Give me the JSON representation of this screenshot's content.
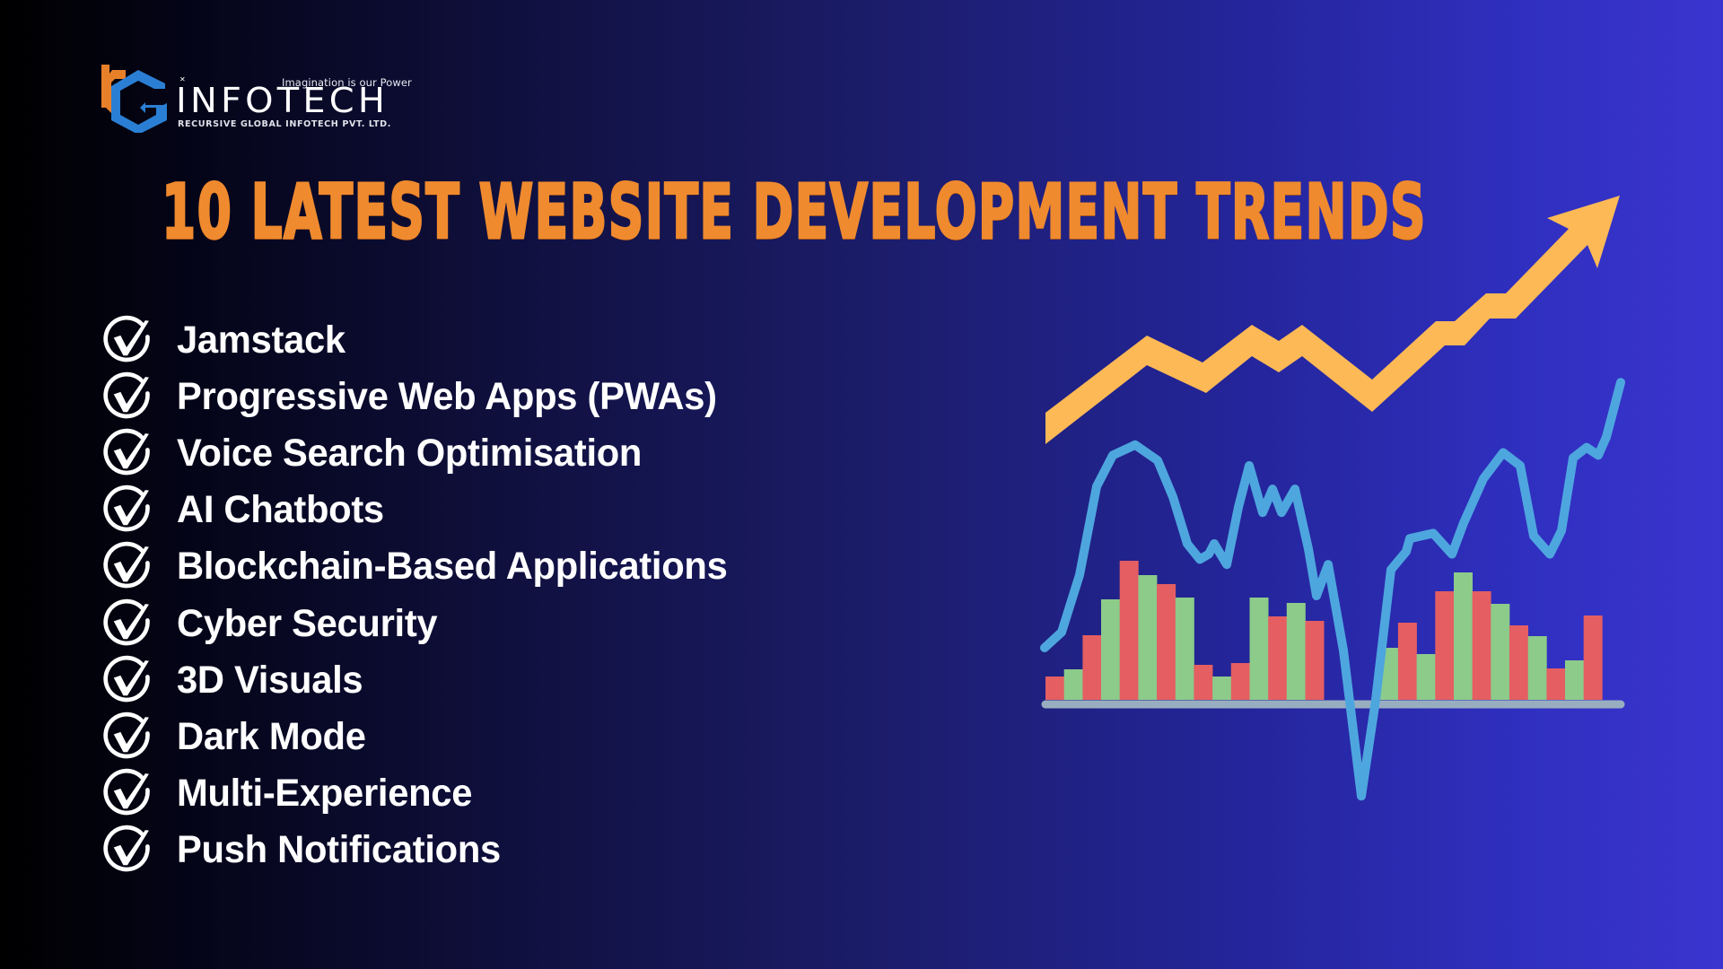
{
  "logo": {
    "mark_letters": "rG",
    "name": "INFOTECH",
    "tagline": "Imagination is our Power",
    "company": "RECURSIVE GLOBAL INFOTECH PVT. LTD.",
    "colors": {
      "r": "#e8802a",
      "g": "#2a7fd4"
    }
  },
  "title": "10 LATEST WEBSITE DEVELOPMENT TRENDS",
  "trends": [
    {
      "label": "Jamstack",
      "icon": "check-circle-icon"
    },
    {
      "label": "Progressive Web Apps (PWAs)",
      "icon": "check-circle-icon"
    },
    {
      "label": "Voice Search Optimisation",
      "icon": "check-circle-icon"
    },
    {
      "label": "AI Chatbots",
      "icon": "check-circle-icon"
    },
    {
      "label": "Blockchain-Based Applications",
      "icon": "check-circle-icon"
    },
    {
      "label": "Cyber Security",
      "icon": "check-circle-icon"
    },
    {
      "label": "3D Visuals",
      "icon": "check-circle-icon"
    },
    {
      "label": "Dark Mode",
      "icon": "check-circle-icon"
    },
    {
      "label": "Multi-Experience",
      "icon": "check-circle-icon"
    },
    {
      "label": "Push Notifications",
      "icon": "check-circle-icon"
    }
  ],
  "colors": {
    "title": "#ef8a2e",
    "arrow": "#fdb956",
    "line": "#4ea6de",
    "bar_red": "#e45e62",
    "bar_green": "#8ccb8a",
    "baseline": "#98aec0"
  },
  "chart_data": {
    "type": "bar",
    "title": "",
    "description": "Decorative growth illustration: upward zig-zag arrow, wavy trend line and red/green bar histogram",
    "groups": [
      {
        "name": "left-group",
        "colors": [
          "red",
          "green",
          "red",
          "green",
          "red",
          "green",
          "red",
          "green",
          "red",
          "green",
          "red",
          "green",
          "red",
          "green",
          "red"
        ],
        "values": [
          26,
          34,
          72,
          112,
          155,
          139,
          129,
          114,
          39,
          26,
          41,
          114,
          93,
          108,
          88
        ]
      },
      {
        "name": "right-group",
        "colors": [
          "green",
          "red",
          "green",
          "red",
          "green",
          "red",
          "green",
          "red",
          "green",
          "red",
          "green",
          "red"
        ],
        "values": [
          58,
          86,
          51,
          121,
          142,
          121,
          107,
          83,
          71,
          35,
          44,
          94
        ]
      }
    ],
    "gap_bars": 3,
    "ylim": [
      0,
      160
    ],
    "arrow_trend": "upward",
    "line_series": [
      20,
      26,
      48,
      82,
      94,
      98,
      92,
      78,
      60,
      54,
      56,
      60,
      52,
      74,
      90,
      72,
      81,
      72,
      81,
      58,
      40,
      52,
      19,
      -37,
      0,
      50,
      57,
      62,
      64,
      56,
      68,
      85,
      95,
      90,
      63,
      56,
      65,
      93,
      97,
      94,
      101,
      122
    ]
  }
}
